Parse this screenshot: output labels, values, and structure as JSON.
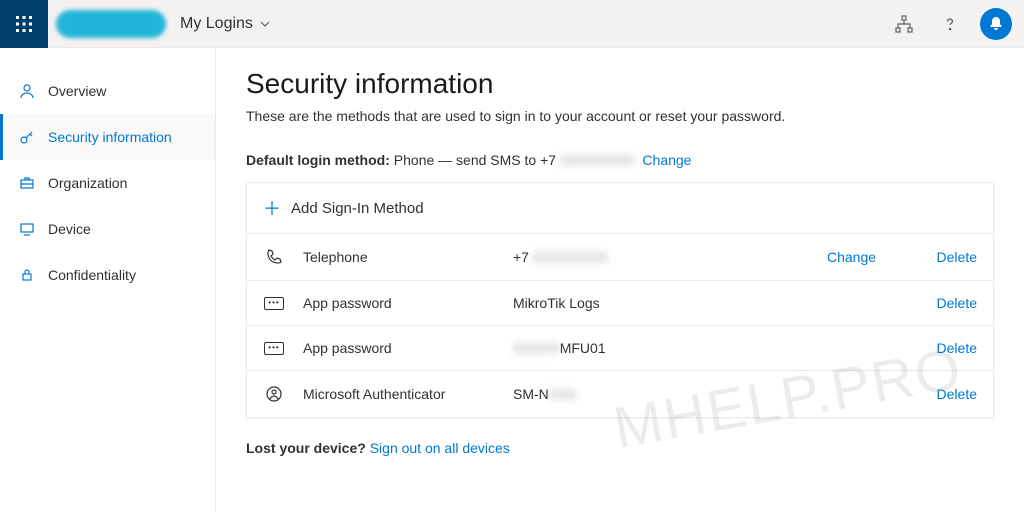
{
  "header": {
    "title": "My Logins"
  },
  "sidebar": {
    "items": [
      {
        "label": "Overview"
      },
      {
        "label": "Security information"
      },
      {
        "label": "Organization"
      },
      {
        "label": "Device"
      },
      {
        "label": "Confidentiality"
      }
    ]
  },
  "page": {
    "title": "Security information",
    "subtitle": "These are the methods that are used to sign in to your account or reset your password.",
    "default_label": "Default login method:",
    "default_value_prefix": "Phone — send SMS to +7 ",
    "default_value_masked": "XXXXXXXX",
    "change": "Change",
    "add_method": "Add Sign-In Method",
    "lost_q": "Lost your device?",
    "signout": "Sign out on all devices"
  },
  "methods": [
    {
      "name": "Telephone",
      "valuePrefix": "+7 ",
      "valueMasked": "XXXXXXXX",
      "change": "Change",
      "del": "Delete"
    },
    {
      "name": "App password",
      "value": "MikroTik Logs",
      "del": "Delete"
    },
    {
      "name": "App password",
      "valueMasked": "XXXXX",
      "valueSuffix": "MFU01",
      "del": "Delete"
    },
    {
      "name": "Microsoft Authenticator",
      "valuePrefix": "SM-N",
      "valueMasked": "XXX",
      "del": "Delete"
    }
  ],
  "watermark": "MHELP.PRO"
}
